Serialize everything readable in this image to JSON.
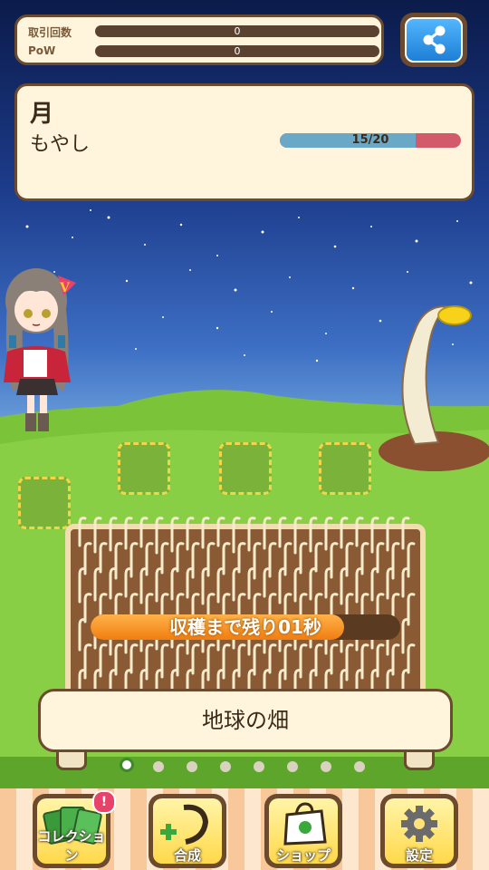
{
  "stats": {
    "trades_label": "取引回数",
    "trades_value": "0",
    "pow_label": "PoW",
    "pow_value": "0"
  },
  "share_button": {
    "icon": "share-icon"
  },
  "info": {
    "location": "月",
    "crop": "もやし",
    "growth_text": "15/20",
    "growth_current": 15,
    "growth_max": 20
  },
  "timer": {
    "text": "収穫まで残り01秒",
    "progress": 0.82
  },
  "field": {
    "name": "地球の畑",
    "pages": 8,
    "active_page": 0
  },
  "nav": {
    "collection": "コレクション",
    "collection_badge": "!",
    "synthesis": "合成",
    "shop": "ショップ",
    "settings": "設定"
  },
  "colors": {
    "panel_bg": "#fff5dc",
    "panel_border": "#6b4a2e",
    "accent_orange": "#f07e10",
    "grass": "#7bc43a"
  }
}
